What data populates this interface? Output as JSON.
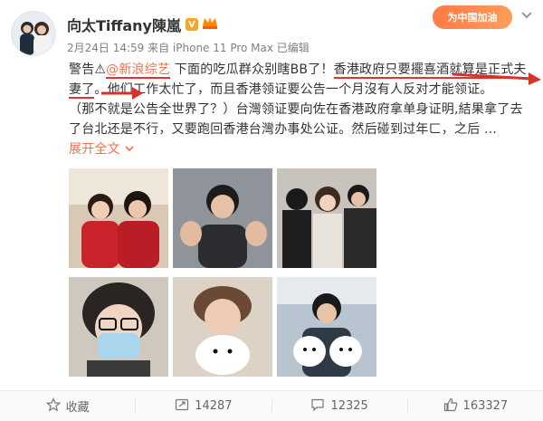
{
  "header": {
    "name": "向太Tiffany陳嵐",
    "verified_mark": "V",
    "meta": "2月24日 14:59 来自 iPhone 11 Pro Max  已编辑",
    "promo_text": "为中国加油"
  },
  "post": {
    "line1_a": "警告⚠",
    "mention": "@新浪综艺",
    "line1_b": " 下面的吃瓜群众别瞎BB了！",
    "line1_c": "香港政府只要擺喜酒就算是正式夫",
    "line2_a": "妻了",
    "line2_b": "。他们工作太忙了，而且香港领证要公告一个月沒有人反对才能领证。",
    "line3": "（那不就是公告全世界了？）台灣领证要向佐在香港政府拿单身证明,結果拿了去",
    "line4": "了台北还是不行，又要跑回香港台灣办事处公证。然后碰到过年ㄈ，之后 ...",
    "expand_label": "展开全文",
    "expand_icon": "chevron-down-icon"
  },
  "photos": [
    {
      "name": "couple-red-sweaters-photo"
    },
    {
      "name": "man-hands-gesture-photo"
    },
    {
      "name": "group-three-people-photo"
    },
    {
      "name": "woman-face-mask-photo"
    },
    {
      "name": "woman-with-puppy-photo"
    },
    {
      "name": "man-holding-puppies-photo"
    }
  ],
  "actions": {
    "favorite_label": "收藏",
    "repost_count": "14287",
    "comment_count": "12325",
    "like_count": "163327"
  },
  "colors": {
    "accent": "#eb7350",
    "underline": "#e5322d",
    "arrow": "#d8312a"
  }
}
